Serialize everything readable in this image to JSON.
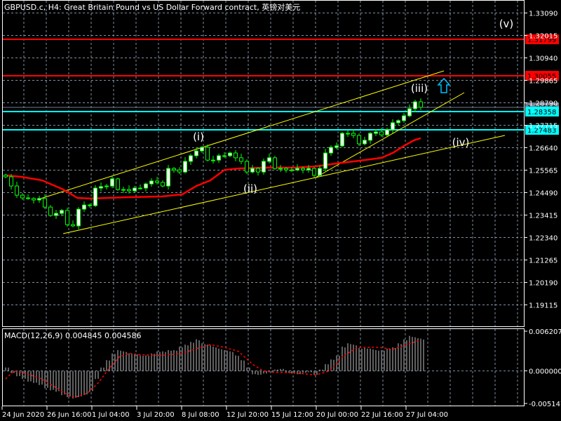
{
  "header": {
    "title": "GBPUSD.c, H4:  Great Britain Pound vs US Dollar Forward contract, 英镑对美元"
  },
  "colors": {
    "background": "#000000",
    "grid": "#8090a0",
    "candle": "#00ff00",
    "bull_body": "#ffffff",
    "bear_body": "#000000",
    "moving_average": "#ff0000",
    "trendline": "#ffff00",
    "resistance": "#ff0000",
    "support": "#00ffff",
    "current_price": "#708090",
    "macd_histogram": "#c0c0c0",
    "macd_signal": "#ff0000",
    "arrow": "#00bfff"
  },
  "chart_data": {
    "type": "candlestick",
    "symbol": "GBPUSD.c",
    "timeframe": "H4",
    "price_axis": {
      "ticks": [
        "1.33090",
        "1.32015",
        "1.30940",
        "1.29865",
        "1.28790",
        "1.27715",
        "1.26640",
        "1.25565",
        "1.24490",
        "1.23415",
        "1.22340",
        "1.21265",
        "1.20190",
        "1.19115"
      ],
      "range": [
        1.188,
        1.337
      ]
    },
    "time_axis": {
      "ticks": [
        "24 Jun 2020",
        "26 Jun 16:00",
        "1 Jul 04:00",
        "3 Jul 20:00",
        "8 Jul 08:00",
        "12 Jul 20:00",
        "15 Jul 12:00",
        "20 Jul 00:00",
        "22 Jul 16:00",
        "27 Jul 04:00"
      ]
    },
    "grid": true,
    "closes": [
      1.2523,
      1.2479,
      1.2435,
      1.2422,
      1.2419,
      1.2412,
      1.2419,
      1.2378,
      1.2338,
      1.2348,
      1.2362,
      1.2294,
      1.2288,
      1.2368,
      1.2388,
      1.2385,
      1.2469,
      1.2476,
      1.2479,
      1.2513,
      1.2462,
      1.2462,
      1.2456,
      1.2469,
      1.2469,
      1.2489,
      1.2503,
      1.2496,
      1.2479,
      1.2563,
      1.2556,
      1.2546,
      1.2597,
      1.2624,
      1.2647,
      1.2664,
      1.2603,
      1.2603,
      1.2624,
      1.2624,
      1.2637,
      1.2614,
      1.2597,
      1.2546,
      1.2563,
      1.2546,
      1.2597,
      1.2614,
      1.2563,
      1.2563,
      1.2556,
      1.2556,
      1.2563,
      1.2556,
      1.2563,
      1.253,
      1.2563,
      1.2637,
      1.2664,
      1.2671,
      1.2731,
      1.2731,
      1.2721,
      1.2681,
      1.2698,
      1.2731,
      1.2738,
      1.2724,
      1.2748,
      1.2782,
      1.2792,
      1.2815,
      1.2849,
      1.2882,
      1.2856
    ],
    "moving_average": [
      [
        0,
        1.253
      ],
      [
        2.8,
        1.2523
      ],
      [
        6.5,
        1.2506
      ],
      [
        10.3,
        1.2462
      ],
      [
        12.8,
        1.2422
      ],
      [
        15.3,
        1.2419
      ],
      [
        21.5,
        1.2425
      ],
      [
        27.8,
        1.2429
      ],
      [
        31.5,
        1.2439
      ],
      [
        34,
        1.2479
      ],
      [
        36.5,
        1.2506
      ],
      [
        39,
        1.2556
      ],
      [
        41.5,
        1.2563
      ],
      [
        46.5,
        1.2567
      ],
      [
        51.5,
        1.2567
      ],
      [
        55.3,
        1.2573
      ],
      [
        59,
        1.2587
      ],
      [
        64,
        1.2603
      ],
      [
        67,
        1.2614
      ],
      [
        69,
        1.2637
      ],
      [
        71,
        1.2671
      ],
      [
        72.8,
        1.2698
      ],
      [
        74,
        1.2708
      ]
    ],
    "horizontal_levels": [
      {
        "price": "1.31799",
        "kind": "resistance"
      },
      {
        "price": "1.30055",
        "kind": "resistance"
      },
      {
        "price": "1.28558",
        "kind": "current_price"
      },
      {
        "price": "1.28358",
        "kind": "support"
      },
      {
        "price": "1.27483",
        "kind": "support"
      }
    ],
    "wave_labels": [
      "(i)",
      "(ii)",
      "(iii)",
      "(iv)",
      "(v)"
    ],
    "macd": {
      "label": "MACD(12,26,9) 0.004845 0.004586",
      "ticks": [
        "0.006207",
        "0.000000",
        "-0.005147"
      ],
      "range": [
        -0.005147,
        0.006207
      ],
      "histogram": [
        0.0005,
        -0.0003,
        -0.0008,
        -0.0012,
        -0.0016,
        -0.0018,
        -0.0021,
        -0.0026,
        -0.0029,
        -0.0031,
        -0.0036,
        -0.0039,
        -0.0041,
        -0.0039,
        -0.0036,
        -0.0031,
        -0.0012,
        0.0005,
        0.0016,
        0.0026,
        0.0031,
        0.0029,
        0.0026,
        0.0025,
        0.0023,
        0.0023,
        0.0026,
        0.0029,
        0.0029,
        0.0031,
        0.0031,
        0.0036,
        0.0039,
        0.0043,
        0.0047,
        0.0041,
        0.0039,
        0.0036,
        0.0033,
        0.0031,
        0.0029,
        0.0023,
        0.0016,
        0.0005,
        -0.0005,
        -0.0006,
        -0.0004,
        -0.0002,
        0.0002,
        0.0003,
        -0.0003,
        -0.0004,
        -0.0005,
        -0.0003,
        -0.0002,
        -0.0006,
        0.0002,
        0.001,
        0.0017,
        0.0023,
        0.0036,
        0.0041,
        0.0039,
        0.0034,
        0.0034,
        0.0033,
        0.0031,
        0.0031,
        0.0033,
        0.0035,
        0.0041,
        0.0047,
        0.0052,
        0.005,
        0.0048
      ],
      "signal": [
        [
          0,
          -0.0012
        ],
        [
          1.5,
          0.0
        ],
        [
          4,
          -0.0005
        ],
        [
          6.5,
          -0.0012
        ],
        [
          9,
          -0.0025
        ],
        [
          11.5,
          -0.0038
        ],
        [
          12.8,
          -0.0038
        ],
        [
          14.6,
          -0.0033
        ],
        [
          16.5,
          -0.0018
        ],
        [
          18.4,
          0.0003
        ],
        [
          20.3,
          0.0021
        ],
        [
          22.1,
          0.0026
        ],
        [
          24,
          0.0024
        ],
        [
          27.8,
          0.0023
        ],
        [
          31.5,
          0.0026
        ],
        [
          34,
          0.0033
        ],
        [
          36.5,
          0.0039
        ],
        [
          39,
          0.0035
        ],
        [
          41.5,
          0.0029
        ],
        [
          44,
          0.001
        ],
        [
          45.9,
          0.0
        ],
        [
          47.8,
          -0.0002
        ],
        [
          51.5,
          -0.0003
        ],
        [
          55.3,
          -0.0006
        ],
        [
          57.8,
          0.0
        ],
        [
          60.3,
          0.0023
        ],
        [
          62.8,
          0.0035
        ],
        [
          66.5,
          0.0035
        ],
        [
          69,
          0.0032
        ],
        [
          71.5,
          0.0039
        ],
        [
          74,
          0.0046
        ]
      ]
    }
  }
}
